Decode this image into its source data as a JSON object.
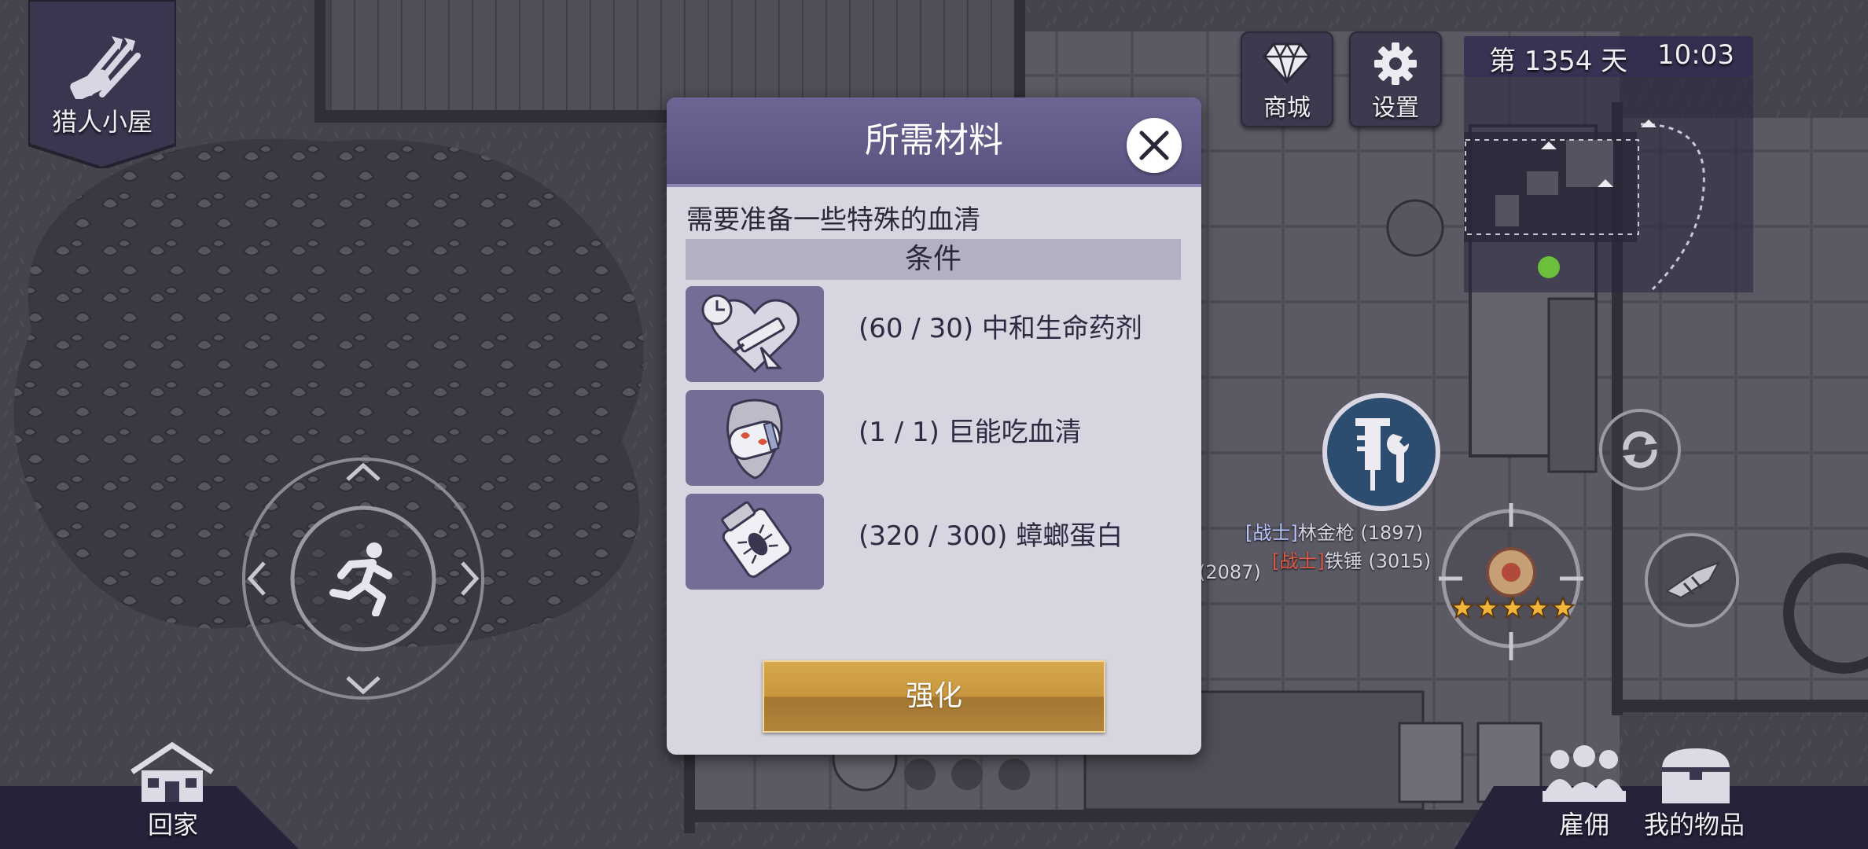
{
  "location": {
    "label": "猎人小屋"
  },
  "top_buttons": {
    "shop": "商城",
    "settings": "设置"
  },
  "clock": {
    "day": "第 1354 天",
    "time": "10:03"
  },
  "modal": {
    "title": "所需材料",
    "description": "需要准备一些特殊的血清",
    "conditions_label": "条件",
    "materials": [
      {
        "icon": "heart-syringe-icon",
        "text": "(60 / 30) 中和生命药剂"
      },
      {
        "icon": "serum-capsule-icon",
        "text": "(1 / 1) 巨能吃血清"
      },
      {
        "icon": "cockroach-vial-icon",
        "text": "(320 / 300) 蟑螂蛋白"
      }
    ],
    "upgrade_button": "强化"
  },
  "npcs": [
    {
      "tag": "[战士]",
      "name": "林金枪 (1897)"
    },
    {
      "tag": "[战士]",
      "name": "铁锤 (3015)"
    },
    {
      "tag": "",
      "name": "(2087)"
    }
  ],
  "bottom": {
    "home": "回家",
    "hire": "雇佣",
    "items": "我的物品"
  },
  "hero_stars": 5
}
